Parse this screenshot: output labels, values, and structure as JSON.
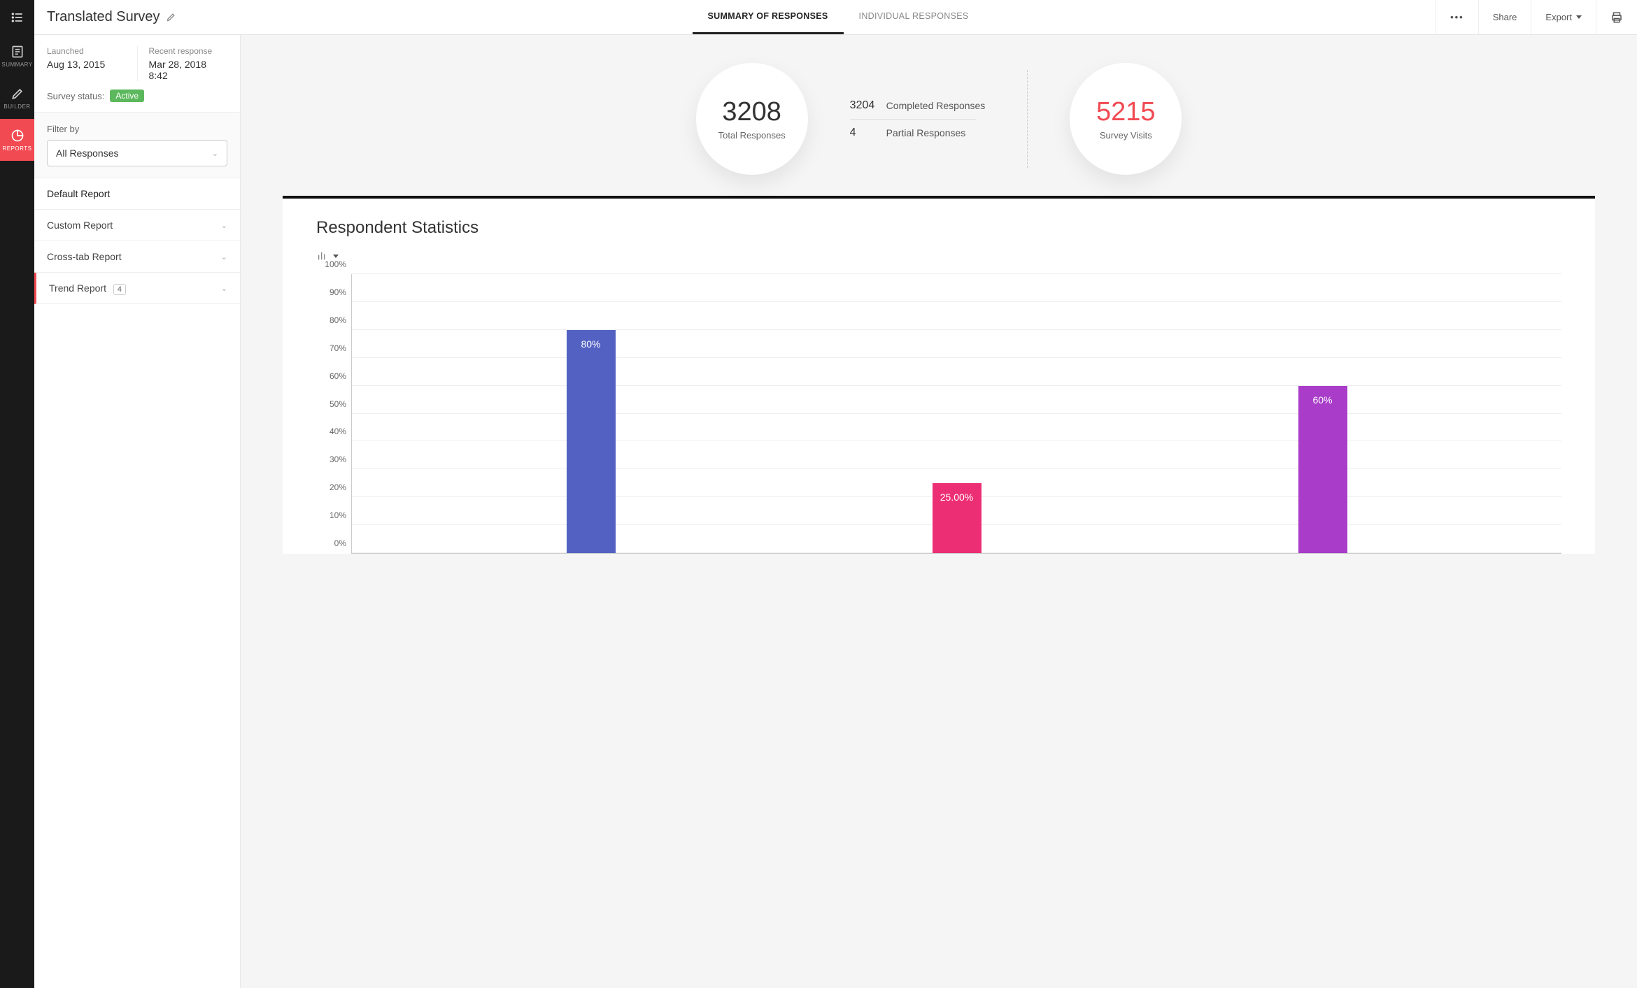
{
  "survey_title": "Translated Survey",
  "tabs": {
    "summary": "SUMMARY OF RESPONSES",
    "individual": "INDIVIDUAL RESPONSES"
  },
  "actions": {
    "share": "Share",
    "export": "Export"
  },
  "nav": {
    "summary": "SUMMARY",
    "builder": "BUILDER",
    "reports": "REPORTS"
  },
  "info": {
    "launched_label": "Launched",
    "launched_value": "Aug 13, 2015",
    "recent_label": "Recent response",
    "recent_value": "Mar 28, 2018 8:42",
    "status_label": "Survey status:",
    "status_value": "Active"
  },
  "filter": {
    "label": "Filter by",
    "selected": "All Responses"
  },
  "reports": {
    "default": "Default Report",
    "custom": "Custom Report",
    "crosstab": "Cross-tab Report",
    "trend": "Trend Report",
    "trend_count": "4"
  },
  "stats": {
    "total_num": "3208",
    "total_label": "Total Responses",
    "completed_num": "3204",
    "completed_label": "Completed Responses",
    "partial_num": "4",
    "partial_label": "Partial Responses",
    "visits_num": "5215",
    "visits_label": "Survey Visits"
  },
  "chart": {
    "title": "Respondent Statistics"
  },
  "chart_data": {
    "type": "bar",
    "title": "Respondent Statistics",
    "ylabel": "",
    "ylim": [
      0,
      100
    ],
    "yticks": [
      "0%",
      "10%",
      "20%",
      "30%",
      "40%",
      "50%",
      "60%",
      "70%",
      "80%",
      "90%",
      "100%"
    ],
    "series": [
      {
        "value": 80,
        "label": "80%",
        "color": "#5362c2"
      },
      {
        "value": 25,
        "label": "25.00%",
        "color": "#ec2f74"
      },
      {
        "value": 60,
        "label": "60%",
        "color": "#a93cc9"
      }
    ]
  }
}
